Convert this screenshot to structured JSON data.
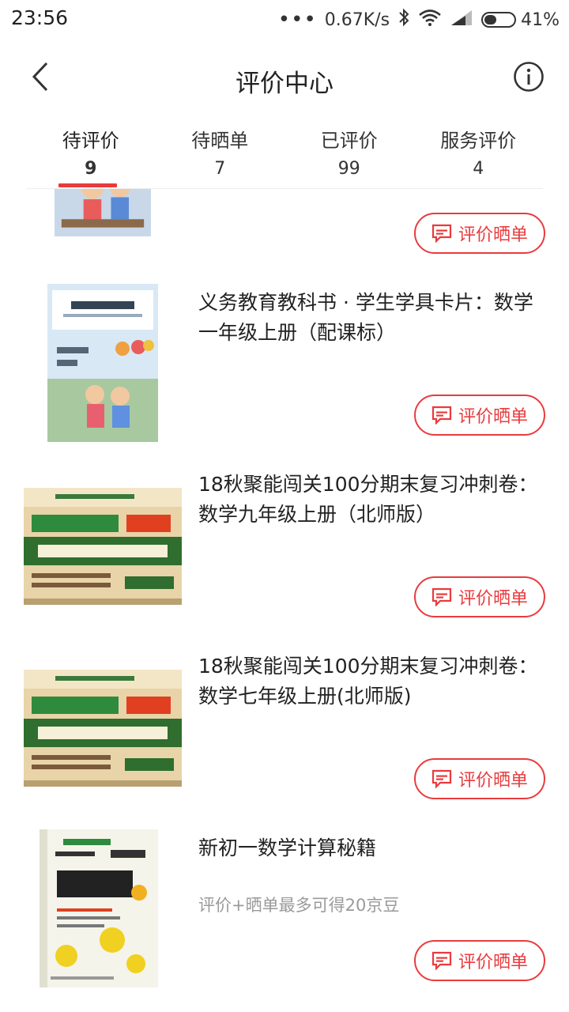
{
  "status_bar": {
    "time": "23:56",
    "network_speed": "0.67K/s",
    "battery_percent": "41%",
    "battery_level": 0.41,
    "icons": [
      "more-dots-icon",
      "bluetooth-icon",
      "wifi-icon",
      "signal-icon",
      "battery-icon"
    ]
  },
  "header": {
    "title": "评价中心",
    "back_icon": "chevron-left-icon",
    "info_icon": "info-icon"
  },
  "tabs": [
    {
      "label": "待评价",
      "count": "9",
      "active": true
    },
    {
      "label": "待晒单",
      "count": "7",
      "active": false
    },
    {
      "label": "已评价",
      "count": "99",
      "active": false
    },
    {
      "label": "服务评价",
      "count": "4",
      "active": false
    }
  ],
  "orders": [
    {
      "title": "",
      "hint": "",
      "button": "评价晒单",
      "thumbnail": "textbook-cover"
    },
    {
      "title": "义务教育教科书 · 学生学具卡片：数学一年级上册（配课标）",
      "hint": "",
      "button": "评价晒单",
      "thumbnail": "textbook-cover"
    },
    {
      "title": "18秋聚能闯关100分期末复习冲刺卷：数学九年级上册（北师版）",
      "hint": "",
      "button": "评价晒单",
      "thumbnail": "exam-book-cover"
    },
    {
      "title": "18秋聚能闯关100分期末复习冲刺卷：数学七年级上册(北师版)",
      "hint": "",
      "button": "评价晒单",
      "thumbnail": "exam-book-cover"
    },
    {
      "title": "新初一数学计算秘籍",
      "hint": "评价+晒单最多可得20京豆",
      "button": "评价晒单",
      "thumbnail": "math-guide-cover"
    }
  ],
  "colors": {
    "accent": "#e93b3d",
    "text": "#222222",
    "muted": "#9a9a9a"
  }
}
